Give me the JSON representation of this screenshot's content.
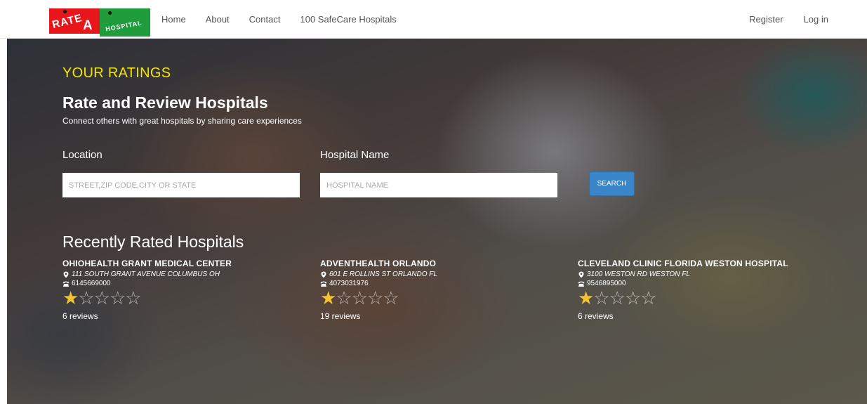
{
  "nav": {
    "logo": {
      "text_rate": "RATE",
      "text_a": "A",
      "text_hospital": "HOSPITAL"
    },
    "links": [
      "Home",
      "About",
      "Contact",
      "100 SafeCare Hospitals"
    ],
    "right_links": [
      "Register",
      "Log in"
    ]
  },
  "hero": {
    "kicker": "YOUR RATINGS",
    "title": "Rate and Review Hospitals",
    "subtitle": "Connect others with great hospitals by sharing care experiences",
    "location_label": "Location",
    "location_placeholder": "STREET,ZIP CODE,CITY OR STATE",
    "hospital_label": "Hospital Name",
    "hospital_placeholder": "HOSPITAL NAME",
    "search_label": "SEARCH"
  },
  "recent": {
    "title": "Recently Rated Hospitals",
    "hospitals": [
      {
        "name": "OHIOHEALTH GRANT MEDICAL CENTER",
        "address": "111 SOUTH GRANT AVENUE COLUMBUS OH",
        "phone": "6145669000",
        "rating": 1,
        "max_rating": 5,
        "reviews": "6 reviews"
      },
      {
        "name": "ADVENTHEALTH ORLANDO",
        "address": "601 E ROLLINS ST ORLANDO FL",
        "phone": "4073031976",
        "rating": 1,
        "max_rating": 5,
        "reviews": "19 reviews"
      },
      {
        "name": "CLEVELAND CLINIC FLORIDA WESTON HOSPITAL",
        "address": "3100 WESTON RD WESTON FL",
        "phone": "9546895000",
        "rating": 1,
        "max_rating": 5,
        "reviews": "6 reviews"
      }
    ]
  },
  "colors": {
    "kicker": "#f2e600",
    "search_button": "#3a86c8",
    "star_on": "#f4c430",
    "logo_red": "#e8161a",
    "logo_green": "#1f9c3b"
  },
  "icons": {
    "address": "map-marker-icon",
    "phone": "phone-icon",
    "star": "star-icon"
  }
}
